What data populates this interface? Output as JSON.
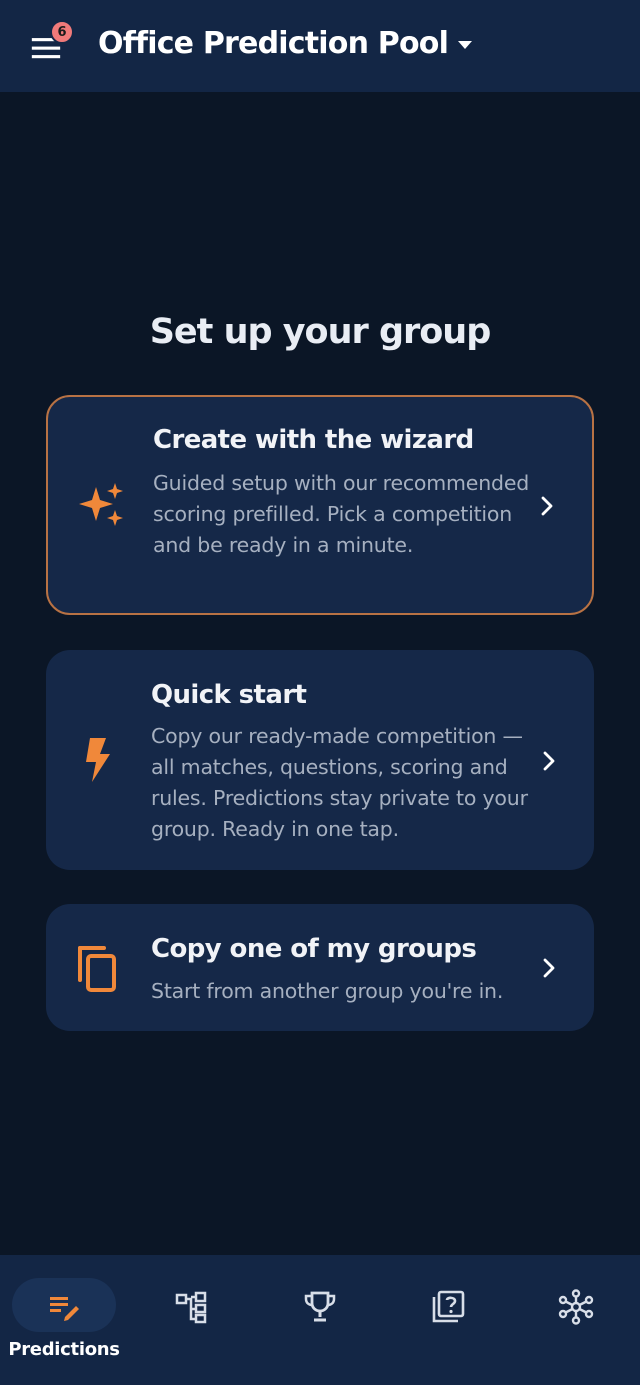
{
  "header": {
    "menu_badge": "6",
    "group_name": "Office Prediction Pool"
  },
  "main": {
    "heading": "Set up your group",
    "options": [
      {
        "title": "Create with the wizard",
        "description": "Guided setup with our recommended scoring prefilled. Pick a competition and be ready in a minute.",
        "icon": "sparkles-icon"
      },
      {
        "title": "Quick start",
        "description": "Copy our ready-made competition — all matches, questions, scoring and rules. Predictions stay private to your group. Ready in one tap.",
        "icon": "lightning-icon"
      },
      {
        "title": "Copy one of my groups",
        "description": "Start from another group you're in.",
        "icon": "copy-icon"
      }
    ]
  },
  "bottom_nav": {
    "items": [
      {
        "label": "Predictions",
        "icon": "predictions-edit-icon",
        "active": true
      },
      {
        "label": "",
        "icon": "bracket-icon",
        "active": false
      },
      {
        "label": "",
        "icon": "trophy-icon",
        "active": false
      },
      {
        "label": "",
        "icon": "questions-icon",
        "active": false
      },
      {
        "label": "",
        "icon": "network-icon",
        "active": false
      }
    ]
  },
  "colors": {
    "background": "#0b1626",
    "surface": "#132645",
    "card": "#152848",
    "accent": "#f0883a",
    "highlight_border": "#b87244",
    "badge": "#f07a7a"
  }
}
